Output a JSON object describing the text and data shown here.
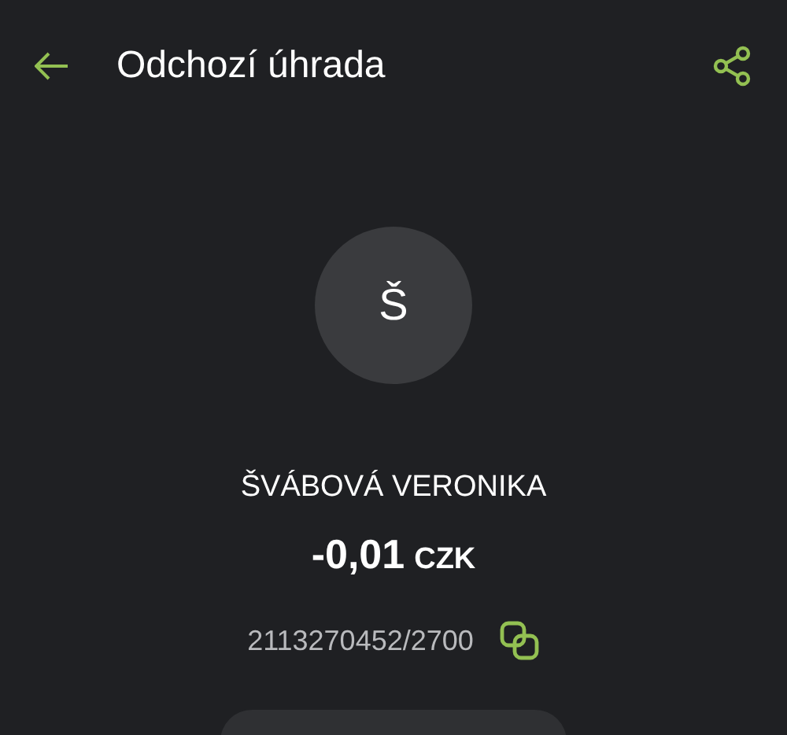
{
  "header": {
    "title": "Odchozí úhrada"
  },
  "avatar": {
    "initial": "Š"
  },
  "payee": {
    "name": "ŠVÁBOVÁ VERONIKA",
    "amount": "-0,01",
    "currency": "CZK",
    "account": "2113270452/2700"
  }
}
